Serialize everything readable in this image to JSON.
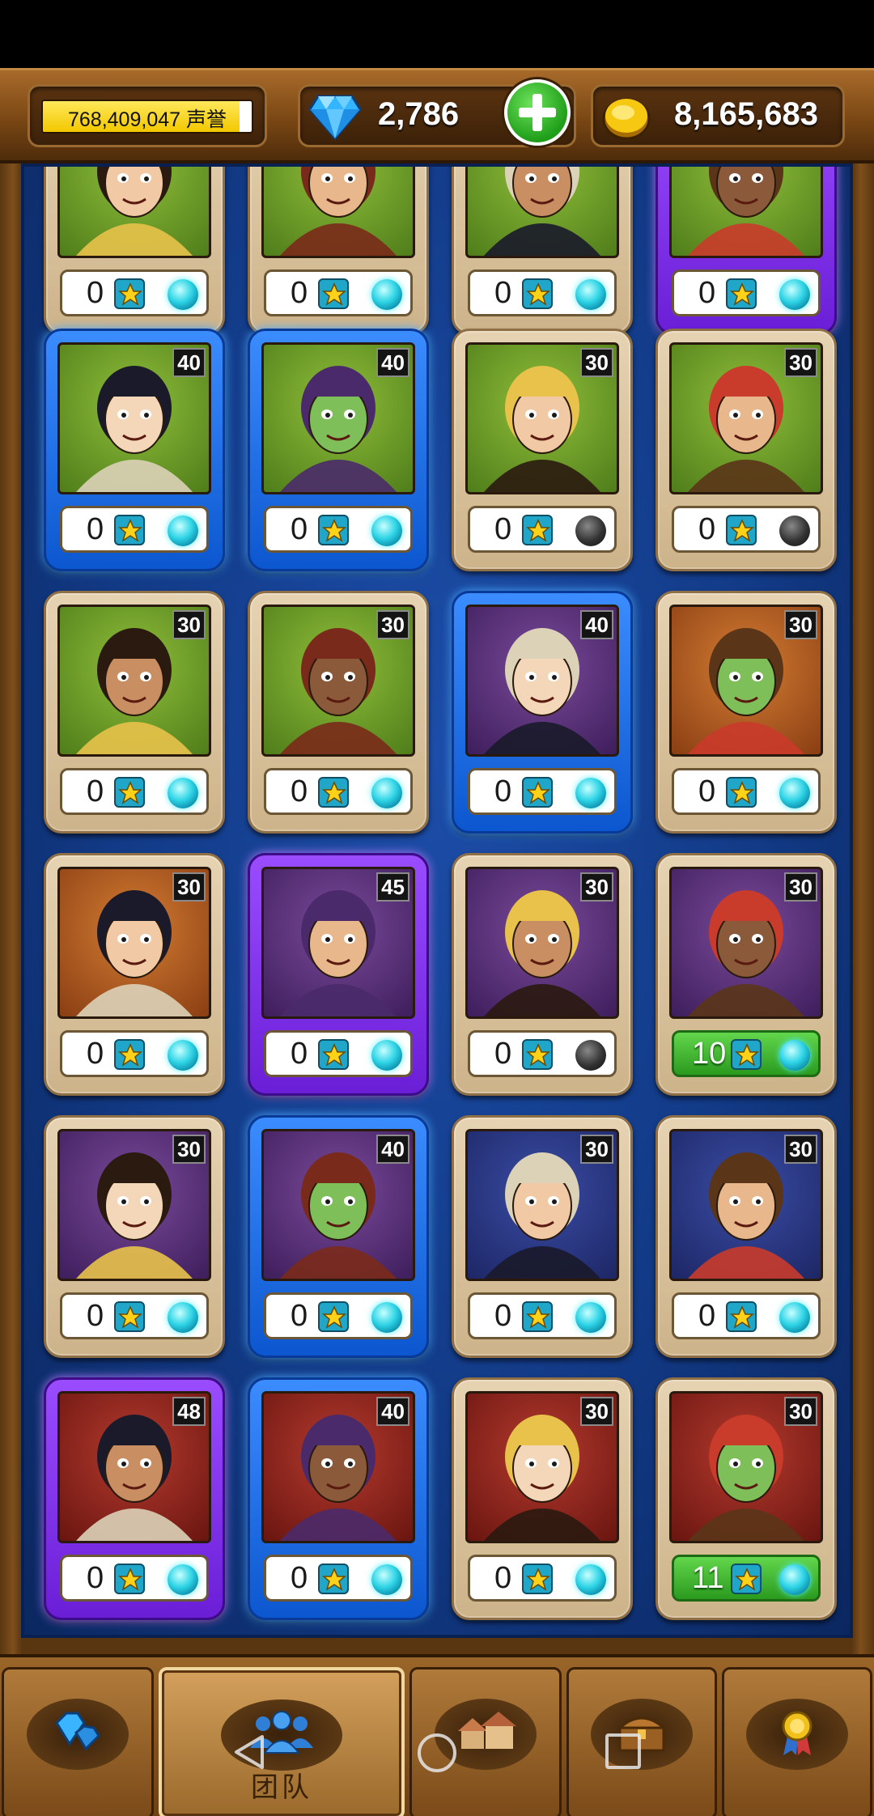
{
  "topbar": {
    "reputation_value": "768,409,047",
    "reputation_label": "声誉",
    "reputation_progress": 0.94,
    "gems": "2,786",
    "gold": "8,165,683"
  },
  "cards": [
    {
      "level": "",
      "count": "0",
      "frame": "normal",
      "bg": "green",
      "orb": "cyan",
      "figure": "bearded-man-icon"
    },
    {
      "level": "",
      "count": "0",
      "frame": "normal",
      "bg": "green",
      "orb": "cyan",
      "figure": "vampire-woman-icon"
    },
    {
      "level": "",
      "count": "0",
      "frame": "normal",
      "bg": "green",
      "orb": "cyan",
      "figure": "troll-icon"
    },
    {
      "level": "",
      "count": "0",
      "frame": "purple",
      "bg": "green",
      "orb": "cyan",
      "figure": "santa-icon"
    },
    {
      "level": "40",
      "count": "0",
      "frame": "blue",
      "bg": "green",
      "orb": "cyan",
      "figure": "wizard-icon"
    },
    {
      "level": "40",
      "count": "0",
      "frame": "blue",
      "bg": "green",
      "orb": "cyan",
      "figure": "dark-hair-woman-icon"
    },
    {
      "level": "30",
      "count": "0",
      "frame": "normal",
      "bg": "green",
      "orb": "dark",
      "figure": "blonde-boy-icon"
    },
    {
      "level": "30",
      "count": "0",
      "frame": "normal",
      "bg": "green",
      "orb": "dark",
      "figure": "green-goblin-girl-icon"
    },
    {
      "level": "30",
      "count": "0",
      "frame": "normal",
      "bg": "green",
      "orb": "cyan",
      "figure": "long-hair-man-icon"
    },
    {
      "level": "30",
      "count": "0",
      "frame": "normal",
      "bg": "green",
      "orb": "cyan",
      "figure": "grinning-man-icon"
    },
    {
      "level": "40",
      "count": "0",
      "frame": "blue",
      "bg": "purple",
      "orb": "cyan",
      "figure": "demon-woman-icon"
    },
    {
      "level": "30",
      "count": "0",
      "frame": "normal",
      "bg": "orange",
      "orb": "cyan",
      "figure": "mustache-man-icon"
    },
    {
      "level": "30",
      "count": "0",
      "frame": "normal",
      "bg": "orange",
      "orb": "cyan",
      "figure": "orc-icon"
    },
    {
      "level": "45",
      "count": "0",
      "frame": "purple",
      "bg": "purple",
      "orb": "cyan",
      "figure": "ghoul-woman-icon"
    },
    {
      "level": "30",
      "count": "0",
      "frame": "normal",
      "bg": "purple",
      "orb": "dark",
      "figure": "gravedigger-icon"
    },
    {
      "level": "30",
      "count": "10",
      "frame": "normal",
      "bg": "purple",
      "orb": "cyan",
      "figure": "pigtail-girl-icon",
      "highlight": true
    },
    {
      "level": "30",
      "count": "0",
      "frame": "normal",
      "bg": "purple",
      "orb": "cyan",
      "figure": "hooded-woman-icon"
    },
    {
      "level": "40",
      "count": "0",
      "frame": "blue",
      "bg": "purple",
      "orb": "cyan",
      "figure": "brute-icon"
    },
    {
      "level": "30",
      "count": "0",
      "frame": "normal",
      "bg": "navy",
      "orb": "cyan",
      "figure": "brown-hair-woman-icon"
    },
    {
      "level": "30",
      "count": "0",
      "frame": "normal",
      "bg": "navy",
      "orb": "cyan",
      "figure": "turban-woman-icon"
    },
    {
      "level": "48",
      "count": "0",
      "frame": "purple",
      "bg": "red",
      "orb": "cyan",
      "figure": "elf-woman-icon"
    },
    {
      "level": "40",
      "count": "0",
      "frame": "blue",
      "bg": "red",
      "orb": "cyan",
      "figure": "fire-elf-icon"
    },
    {
      "level": "30",
      "count": "0",
      "frame": "normal",
      "bg": "red",
      "orb": "cyan",
      "figure": "matchstick-boy-icon"
    },
    {
      "level": "30",
      "count": "11",
      "frame": "normal",
      "bg": "red",
      "orb": "cyan",
      "figure": "captain-girl-icon",
      "highlight": true
    }
  ],
  "nav": {
    "tabs": [
      {
        "name": "gems",
        "icon": "gems-icon",
        "label": ""
      },
      {
        "name": "team",
        "icon": "team-icon",
        "label": "团队",
        "active": true
      },
      {
        "name": "buildings",
        "icon": "buildings-icon",
        "label": ""
      },
      {
        "name": "chest",
        "icon": "chest-icon",
        "label": ""
      },
      {
        "name": "awards",
        "icon": "medal-icon",
        "label": ""
      }
    ]
  },
  "system_nav": [
    "back-icon",
    "home-icon",
    "recents-icon"
  ]
}
